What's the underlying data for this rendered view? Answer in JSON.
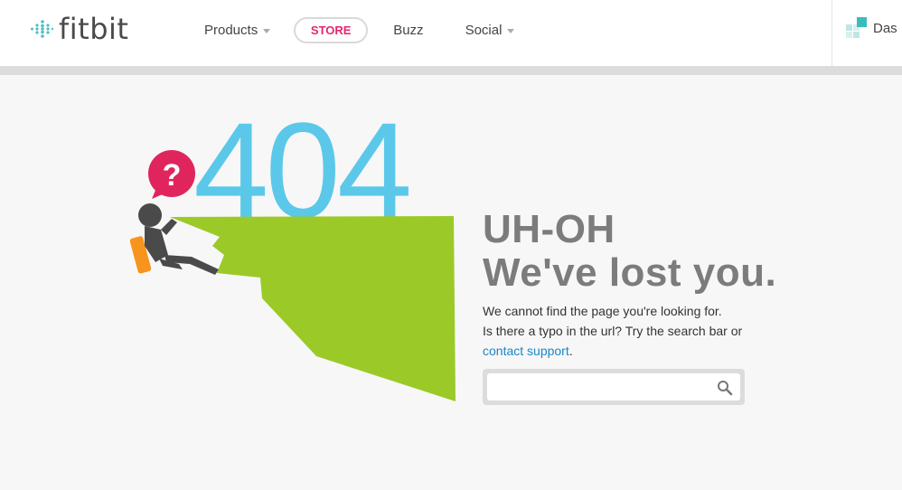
{
  "header": {
    "logo_text": "fitbit",
    "nav": {
      "products": "Products",
      "store": "STORE",
      "buzz": "Buzz",
      "social": "Social"
    },
    "dashboard_label": "Das"
  },
  "illustration": {
    "error_code": "404",
    "bubble_glyph": "?"
  },
  "error": {
    "line1": "UH-OH",
    "line2": "We've lost you.",
    "msg1": "We cannot find the page you're looking for.",
    "msg2": "Is there a typo in the url? Try the search bar or",
    "link": "contact support",
    "period": "."
  },
  "search": {
    "placeholder": ""
  },
  "colors": {
    "brand_teal": "#4cc0c0",
    "store_pink": "#e6266f",
    "code_blue": "#5bc8ea",
    "cliff_green": "#9bca28",
    "heading_gray": "#7c7c7c",
    "link_blue": "#1a86c8",
    "bubble_pink": "#e0255d",
    "backpack_orange": "#f7941d"
  },
  "icons": [
    "fitbit-logo-icon",
    "caret-down-icon",
    "dashboard-icon",
    "question-bubble-icon",
    "climber-icon",
    "search-icon"
  ]
}
